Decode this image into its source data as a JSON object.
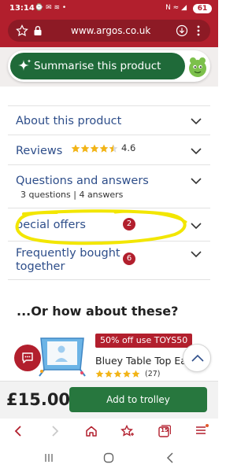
{
  "status": {
    "time": "13:14",
    "left_icons": "⌚ ✉ ≋ •",
    "right_icons": "N ≈ ◢",
    "battery": "61"
  },
  "browser": {
    "url": "www.argos.co.uk"
  },
  "summarise": {
    "label": "Summarise this product"
  },
  "accordion": {
    "about": "About this product",
    "reviews": "Reviews",
    "reviews_rating": "4.6",
    "reviews_stars": 4.5,
    "qa": "Questions and answers",
    "qa_sub": "3 questions | 4 answers",
    "offers": "pecial offers",
    "offers_count": "2",
    "fbt_line1": "Frequently bought",
    "fbt_line2": "together",
    "fbt_count": "6"
  },
  "recommend": {
    "title": "...Or how about these?",
    "promo": "50% off use TOYS50",
    "name": "Bluey Table Top Easel",
    "stars": 5,
    "count": "(27)"
  },
  "buy": {
    "price": "£15.00",
    "add_label": "Add to trolley"
  },
  "bottom_nav": {
    "tab_count": "15"
  },
  "colors": {
    "brand_red": "#b21f2d",
    "link_blue": "#2e4e8a",
    "green": "#27773e",
    "highlight_yellow": "#f2e600"
  }
}
